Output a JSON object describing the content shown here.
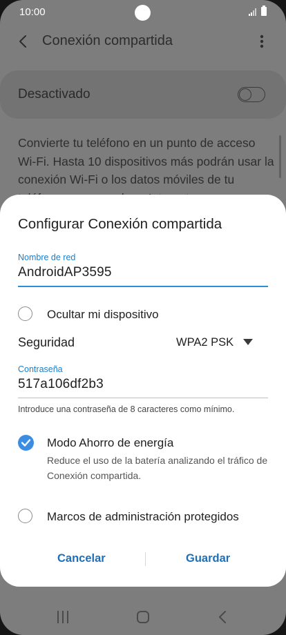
{
  "status_bar": {
    "time": "10:00"
  },
  "app_bar": {
    "title": "Conexión compartida"
  },
  "background": {
    "toggle_label": "Desactivado",
    "description": "Convierte tu teléfono en un punto de acceso Wi-Fi. Hasta 10 dispositivos más podrán usar la conexión Wi-Fi o los datos móviles de tu teléfono para acceder a Internet."
  },
  "dialog": {
    "title": "Configurar Conexión compartida",
    "network_name": {
      "label": "Nombre de red",
      "value": "AndroidAP3595"
    },
    "hide_device": {
      "label": "Ocultar mi dispositivo",
      "checked": false
    },
    "security": {
      "label": "Seguridad",
      "value": "WPA2 PSK"
    },
    "password": {
      "label": "Contraseña",
      "value": "517a106df2b3",
      "hint": "Introduce una contraseña de 8 caracteres como mínimo."
    },
    "power_saving": {
      "label": "Modo Ahorro de energía",
      "description": "Reduce el uso de la batería analizando el tráfico de Conexión compartida.",
      "checked": true
    },
    "pmf": {
      "label": "Marcos de administración protegidos",
      "checked": false
    },
    "cancel_label": "Cancelar",
    "save_label": "Guardar"
  },
  "colors": {
    "accent": "#3a8de3",
    "button_text": "#1d6fb8",
    "field_label": "#1a7ec9",
    "dim_background": "#7d7d7d"
  },
  "icons": {
    "back": "chevron-left-icon",
    "more": "more-vertical-icon",
    "dropdown": "caret-down-icon",
    "check": "check-icon",
    "nav_recent": "recent-apps-icon",
    "nav_home": "home-icon",
    "nav_back": "back-icon"
  }
}
